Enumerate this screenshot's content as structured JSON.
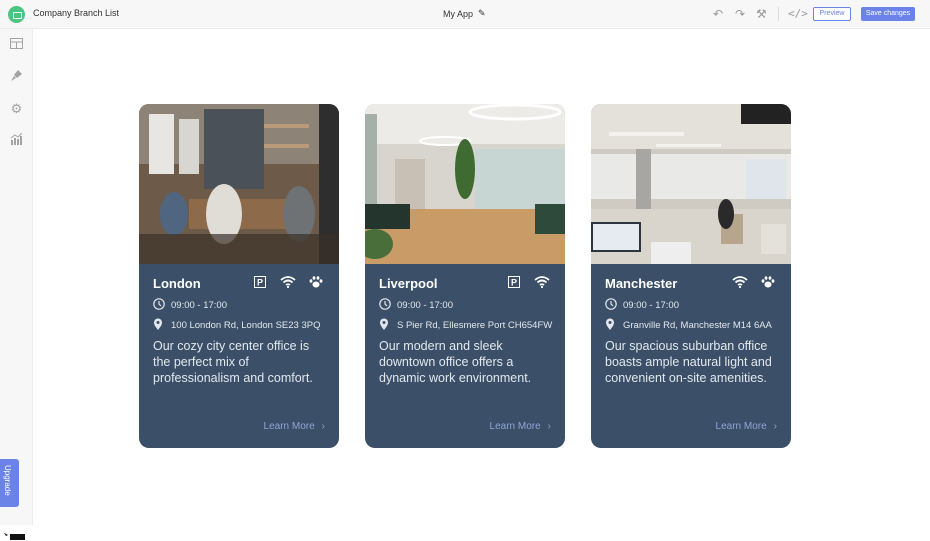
{
  "topbar": {
    "app_name": "Company Branch List",
    "center_title": "My App",
    "preview_label": "Preview",
    "save_label": "Save changes"
  },
  "sidebar": {
    "items": [
      {
        "icon": "table-icon"
      },
      {
        "icon": "brush-icon"
      },
      {
        "icon": "gear-icon"
      },
      {
        "icon": "analytics-icon"
      }
    ],
    "upgrade_label": "Upgrade"
  },
  "cards": [
    {
      "title": "London",
      "amenities": [
        "parking",
        "wifi",
        "pets"
      ],
      "hours": "09:00 - 17:00",
      "address": "100 London Rd, London SE23 3PQ",
      "description": "Our cozy city center office is the perfect mix of professionalism and comfort.",
      "link": "Learn More"
    },
    {
      "title": "Liverpool",
      "amenities": [
        "parking",
        "wifi"
      ],
      "hours": "09:00 - 17:00",
      "address": "S Pier Rd, Ellesmere Port CH654FW",
      "description": "Our modern and sleek downtown office offers a dynamic work environment.",
      "link": "Learn More"
    },
    {
      "title": "Manchester",
      "amenities": [
        "wifi",
        "pets"
      ],
      "hours": "09:00 - 17:00",
      "address": "Granville Rd, Manchester M14 6AA",
      "description": "Our spacious suburban office boasts ample natural light and convenient on-site amenities.",
      "link": "Learn More"
    }
  ],
  "colors": {
    "card_bg": "#3b5068",
    "accent": "#6b83e6",
    "logo_green": "#4cc581",
    "link": "#8fa3d6"
  }
}
